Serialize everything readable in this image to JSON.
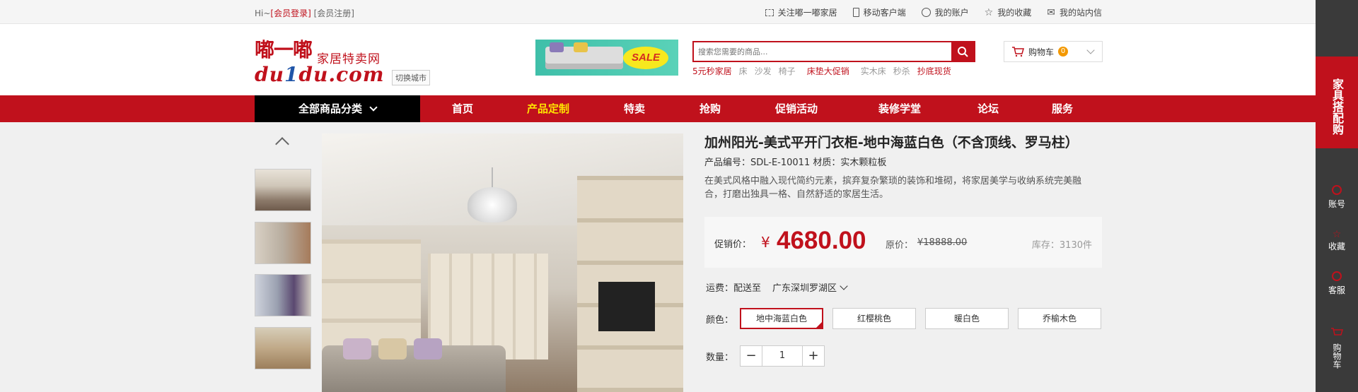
{
  "topbar": {
    "greeting": "Hi~",
    "login": "[会员登录]",
    "register": "[会员注册]",
    "links": [
      {
        "icon": "subscribe-icon",
        "label": "关注嘟一嘟家居"
      },
      {
        "icon": "mobile-icon",
        "label": "移动客户端"
      },
      {
        "icon": "user-icon",
        "label": "我的账户"
      },
      {
        "icon": "star-icon",
        "label": "我的收藏"
      },
      {
        "icon": "mail-icon",
        "label": "我的站内信"
      }
    ]
  },
  "header": {
    "logo_cn": "嘟一嘟",
    "logo_sub": "家居特卖网",
    "logo_en_a": "du",
    "logo_en_b": "1",
    "logo_en_c": "du.com",
    "city_switch": "切换城市",
    "banner_text": "SALE",
    "search_placeholder": "搜索您需要的商品...",
    "hotwords": [
      {
        "label": "5元秒家居",
        "hot": true
      },
      {
        "label": "床",
        "hot": false
      },
      {
        "label": "沙发",
        "hot": false
      },
      {
        "label": "椅子",
        "hot": false
      },
      {
        "label": "床垫大促销",
        "hot": true
      },
      {
        "label": "实木床",
        "hot": false
      },
      {
        "label": "秒杀",
        "hot": false
      },
      {
        "label": "抄底现货",
        "hot": true
      }
    ],
    "cart_label": "购物车",
    "cart_count": "0"
  },
  "nav": {
    "all_categories": "全部商品分类",
    "items": [
      {
        "label": "首页",
        "active": false
      },
      {
        "label": "产品定制",
        "active": true
      },
      {
        "label": "特卖",
        "active": false
      },
      {
        "label": "抢购",
        "active": false
      },
      {
        "label": "促销活动",
        "active": false
      },
      {
        "label": "装修学堂",
        "active": false
      },
      {
        "label": "论坛",
        "active": false
      },
      {
        "label": "服务",
        "active": false
      }
    ]
  },
  "product": {
    "title": "加州阳光-美式平开门衣柜-地中海蓝白色（不含顶线、罗马柱）",
    "code_line": "产品编号：SDL-E-10011 材质：实木颗粒板",
    "description": "在美式风格中融入现代简约元素，摈弃复杂繁琐的装饰和堆砌，将家居美学与收纳系统完美融合，打磨出独具一格、自然舒适的家居生活。",
    "price_label": "促销价：",
    "currency": "¥",
    "price": "4680.00",
    "original_label": "原价：",
    "original_price": "¥18888.00",
    "stock": "库存：3130件",
    "shipping_label": "运费：配送至",
    "shipping_region": "广东深圳罗湖区",
    "color_label": "颜色：",
    "colors": [
      {
        "label": "地中海蓝白色",
        "selected": true
      },
      {
        "label": "红樱桃色",
        "selected": false
      },
      {
        "label": "暖白色",
        "selected": false
      },
      {
        "label": "乔榆木色",
        "selected": false
      }
    ],
    "qty_label": "数量：",
    "qty_minus": "−",
    "qty_value": "1",
    "qty_plus": "+"
  },
  "sidebar": {
    "promo": "家具搭配购",
    "items": [
      {
        "label": "账号",
        "icon": "account-icon"
      },
      {
        "label": "收藏",
        "icon": "favorite-icon"
      },
      {
        "label": "客服",
        "icon": "service-icon"
      }
    ],
    "cart": "购物车"
  },
  "colors": {
    "brand_red": "#c0111c",
    "nav_active": "#ffe400",
    "dark": "#3a3a3a"
  }
}
